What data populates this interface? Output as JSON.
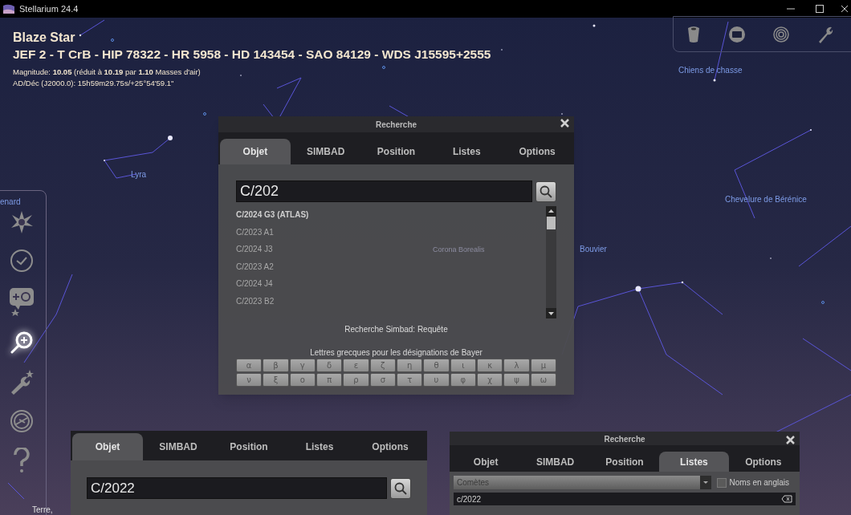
{
  "window": {
    "title": "Stellarium 24.4"
  },
  "object_info": {
    "name": "Blaze Star",
    "designations": "JEF 2 - T CrB - HIP 78322 - HR 5958 - HD 143454 - SAO 84129 - WDS J15595+2555",
    "magnitude": "Magnitude: **10.05** (réduit à **10.19** par **1.10** Masses d'air)",
    "radec": "AD/Déc (J2000.0): 15h59m29.75s/+25°54'59.1\""
  },
  "sky_labels": [
    {
      "text": "Lyra"
    },
    {
      "text": "Chiens de chasse"
    },
    {
      "text": "Chevelure de Bérénice"
    },
    {
      "text": "Bouvier"
    },
    {
      "text": "enard"
    },
    {
      "text": "Terre,"
    }
  ],
  "top_toolbar": [
    {
      "kind": "bucket"
    },
    {
      "kind": "screen"
    },
    {
      "kind": "target"
    },
    {
      "kind": "wrench"
    }
  ],
  "left_toolbar": [
    {
      "kind": "sun",
      "selected": false
    },
    {
      "kind": "clock",
      "selected": false
    },
    {
      "kind": "nebula",
      "selected": false
    },
    {
      "kind": "search",
      "selected": true
    },
    {
      "kind": "wrench",
      "selected": false
    },
    {
      "kind": "compass",
      "selected": false
    },
    {
      "kind": "help",
      "selected": false
    }
  ],
  "search_dialog": {
    "title": "Recherche",
    "tabs": [
      {
        "label": "Objet",
        "selected": true
      },
      {
        "label": "SIMBAD",
        "selected": false
      },
      {
        "label": "Position",
        "selected": false
      },
      {
        "label": "Listes",
        "selected": false
      },
      {
        "label": "Options",
        "selected": false
      }
    ],
    "query": "C/202",
    "results": [
      {
        "text": "C/2024 G3 (ATLAS)",
        "selected": true
      },
      {
        "text": "C/2023 A1",
        "selected": false
      },
      {
        "text": "C/2024 J3",
        "selected": false
      },
      {
        "text": "C/2023 A2",
        "selected": false
      },
      {
        "text": "C/2024 J4",
        "selected": false
      },
      {
        "text": "C/2023 B2",
        "selected": false
      }
    ],
    "background_label": "Corona Borealis",
    "status": "Recherche Simbad: Requête",
    "greek_label": "Lettres grecques pour les désignations de Bayer",
    "greek_letters": [
      "α",
      "β",
      "γ",
      "δ",
      "ε",
      "ζ",
      "η",
      "θ",
      "ι",
      "κ",
      "λ",
      "μ",
      "ν",
      "ξ",
      "ο",
      "π",
      "ρ",
      "σ",
      "τ",
      "υ",
      "φ",
      "χ",
      "ψ",
      "ω"
    ]
  },
  "lower_left_dialog": {
    "tabs": [
      {
        "label": "Objet",
        "selected": true
      },
      {
        "label": "SIMBAD",
        "selected": false
      },
      {
        "label": "Position",
        "selected": false
      },
      {
        "label": "Listes",
        "selected": false
      },
      {
        "label": "Options",
        "selected": false
      }
    ],
    "query": "C/2022"
  },
  "lower_right_dialog": {
    "title": "Recherche",
    "tabs": [
      {
        "label": "Objet",
        "selected": false
      },
      {
        "label": "SIMBAD",
        "selected": false
      },
      {
        "label": "Position",
        "selected": false
      },
      {
        "label": "Listes",
        "selected": true
      },
      {
        "label": "Options",
        "selected": false
      }
    ],
    "list": "Comètes",
    "english_names": {
      "label": "Noms en anglais",
      "checked": false
    },
    "filter": "c/2022"
  }
}
